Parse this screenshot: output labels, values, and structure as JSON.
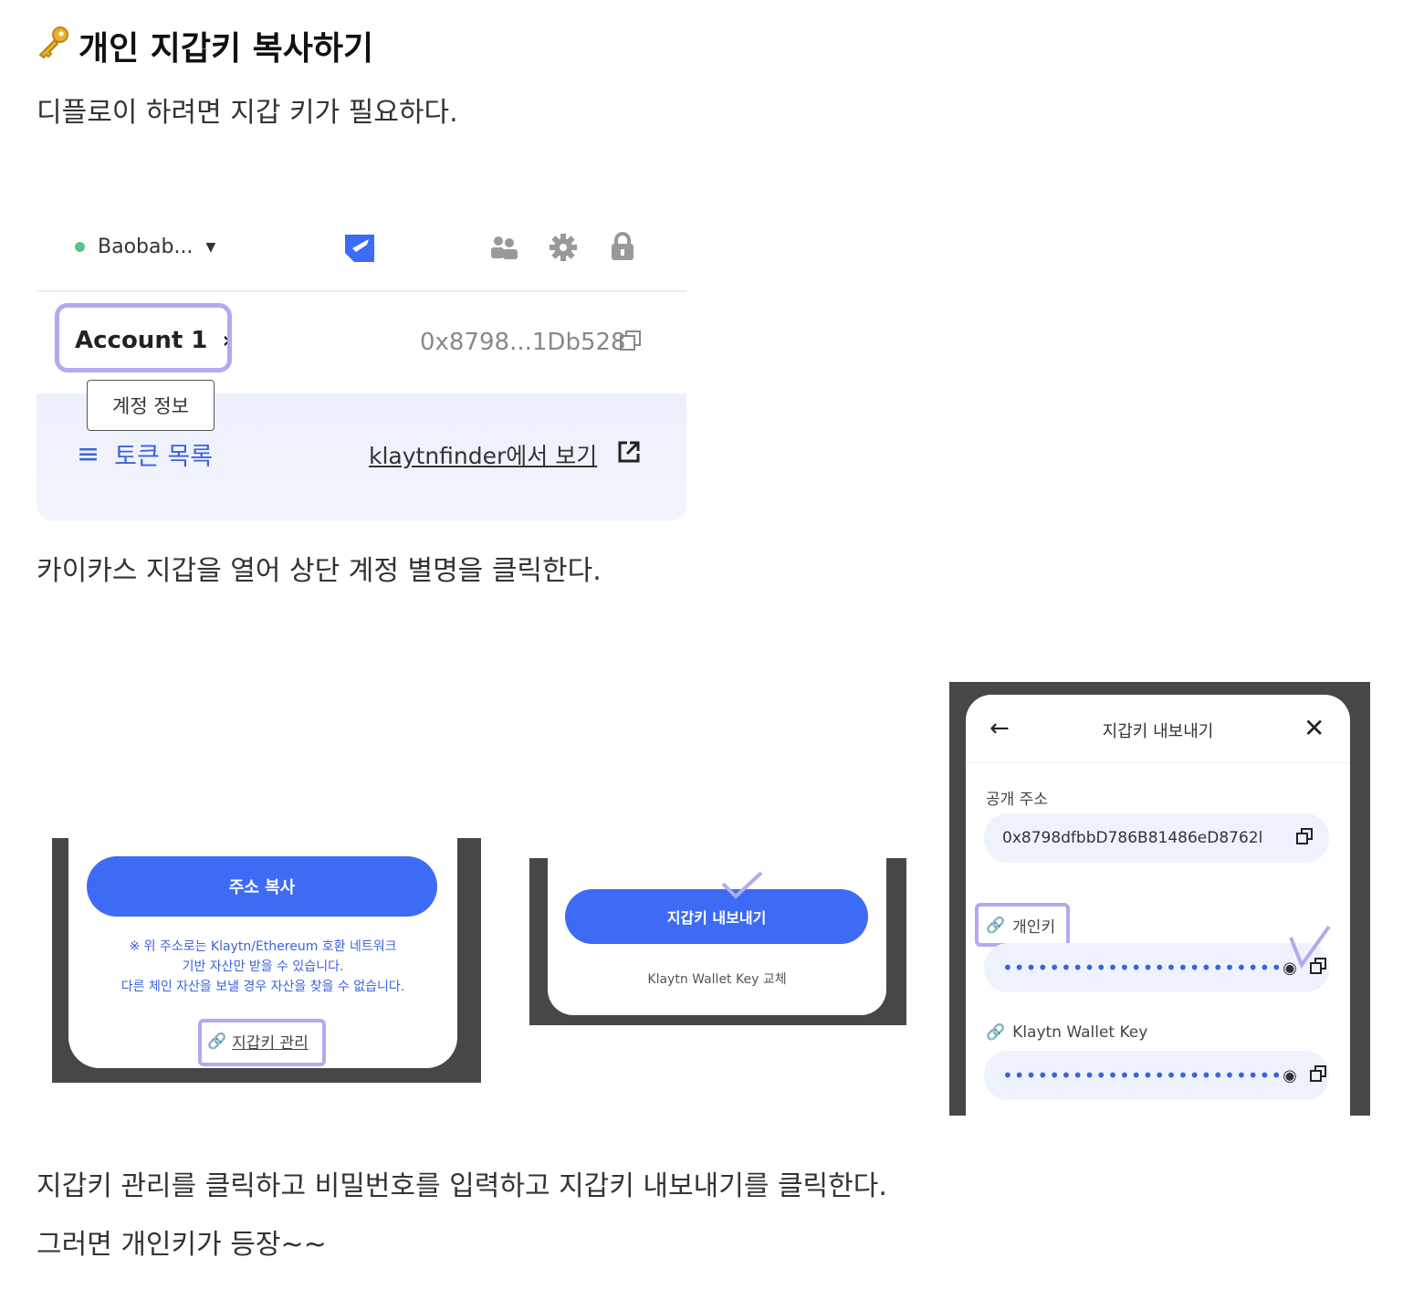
{
  "heading": {
    "icon": "key-icon",
    "text": "개인 지갑키 복사하기"
  },
  "paragraphs": {
    "p1": "디플로이 하려면 지갑 키가 필요하다.",
    "p2": "카이카스 지갑을 열어 상단 계정 별명을 클릭한다.",
    "p3": "지갑키 관리를 클릭하고 비밀번호를 입력하고 지갑키 내보내기를 클릭한다.",
    "p4": "그러면 개인키가 등장~~"
  },
  "panel1": {
    "network": "Baobab...",
    "account": "Account 1",
    "address": "0x8798...1Db528",
    "tooltip": "계정 정보",
    "token_list": "토큰 목록",
    "finder_link": "klaytnfinder에서 보기"
  },
  "panel2": {
    "copy_button": "주소 복사",
    "notice_lines": [
      "※ 위 주소로는 Klaytn/Ethereum 호환 네트워크",
      "기반 자산만 받을 수 있습니다.",
      "다른 체인 자산을 보낼 경우 자산을 찾을 수 없습니다."
    ],
    "manage_keys": "지갑키 관리"
  },
  "panel3": {
    "export_button": "지갑키 내보내기",
    "replace_link": "Klaytn Wallet Key 교체"
  },
  "panel4": {
    "title": "지갑키 내보내기",
    "public_address_label": "공개 주소",
    "public_address": "0x8798dfbbD786B81486eD8762l",
    "private_key_label": "개인키",
    "private_key_mask": "••••••••••••••••••••••••",
    "wallet_key_label": "Klaytn Wallet Key",
    "wallet_key_mask": "••••••••••••••••••••••••"
  },
  "colors": {
    "accent": "#3d6bf5",
    "highlight": "#b5a8f0",
    "frame": "#474747"
  }
}
